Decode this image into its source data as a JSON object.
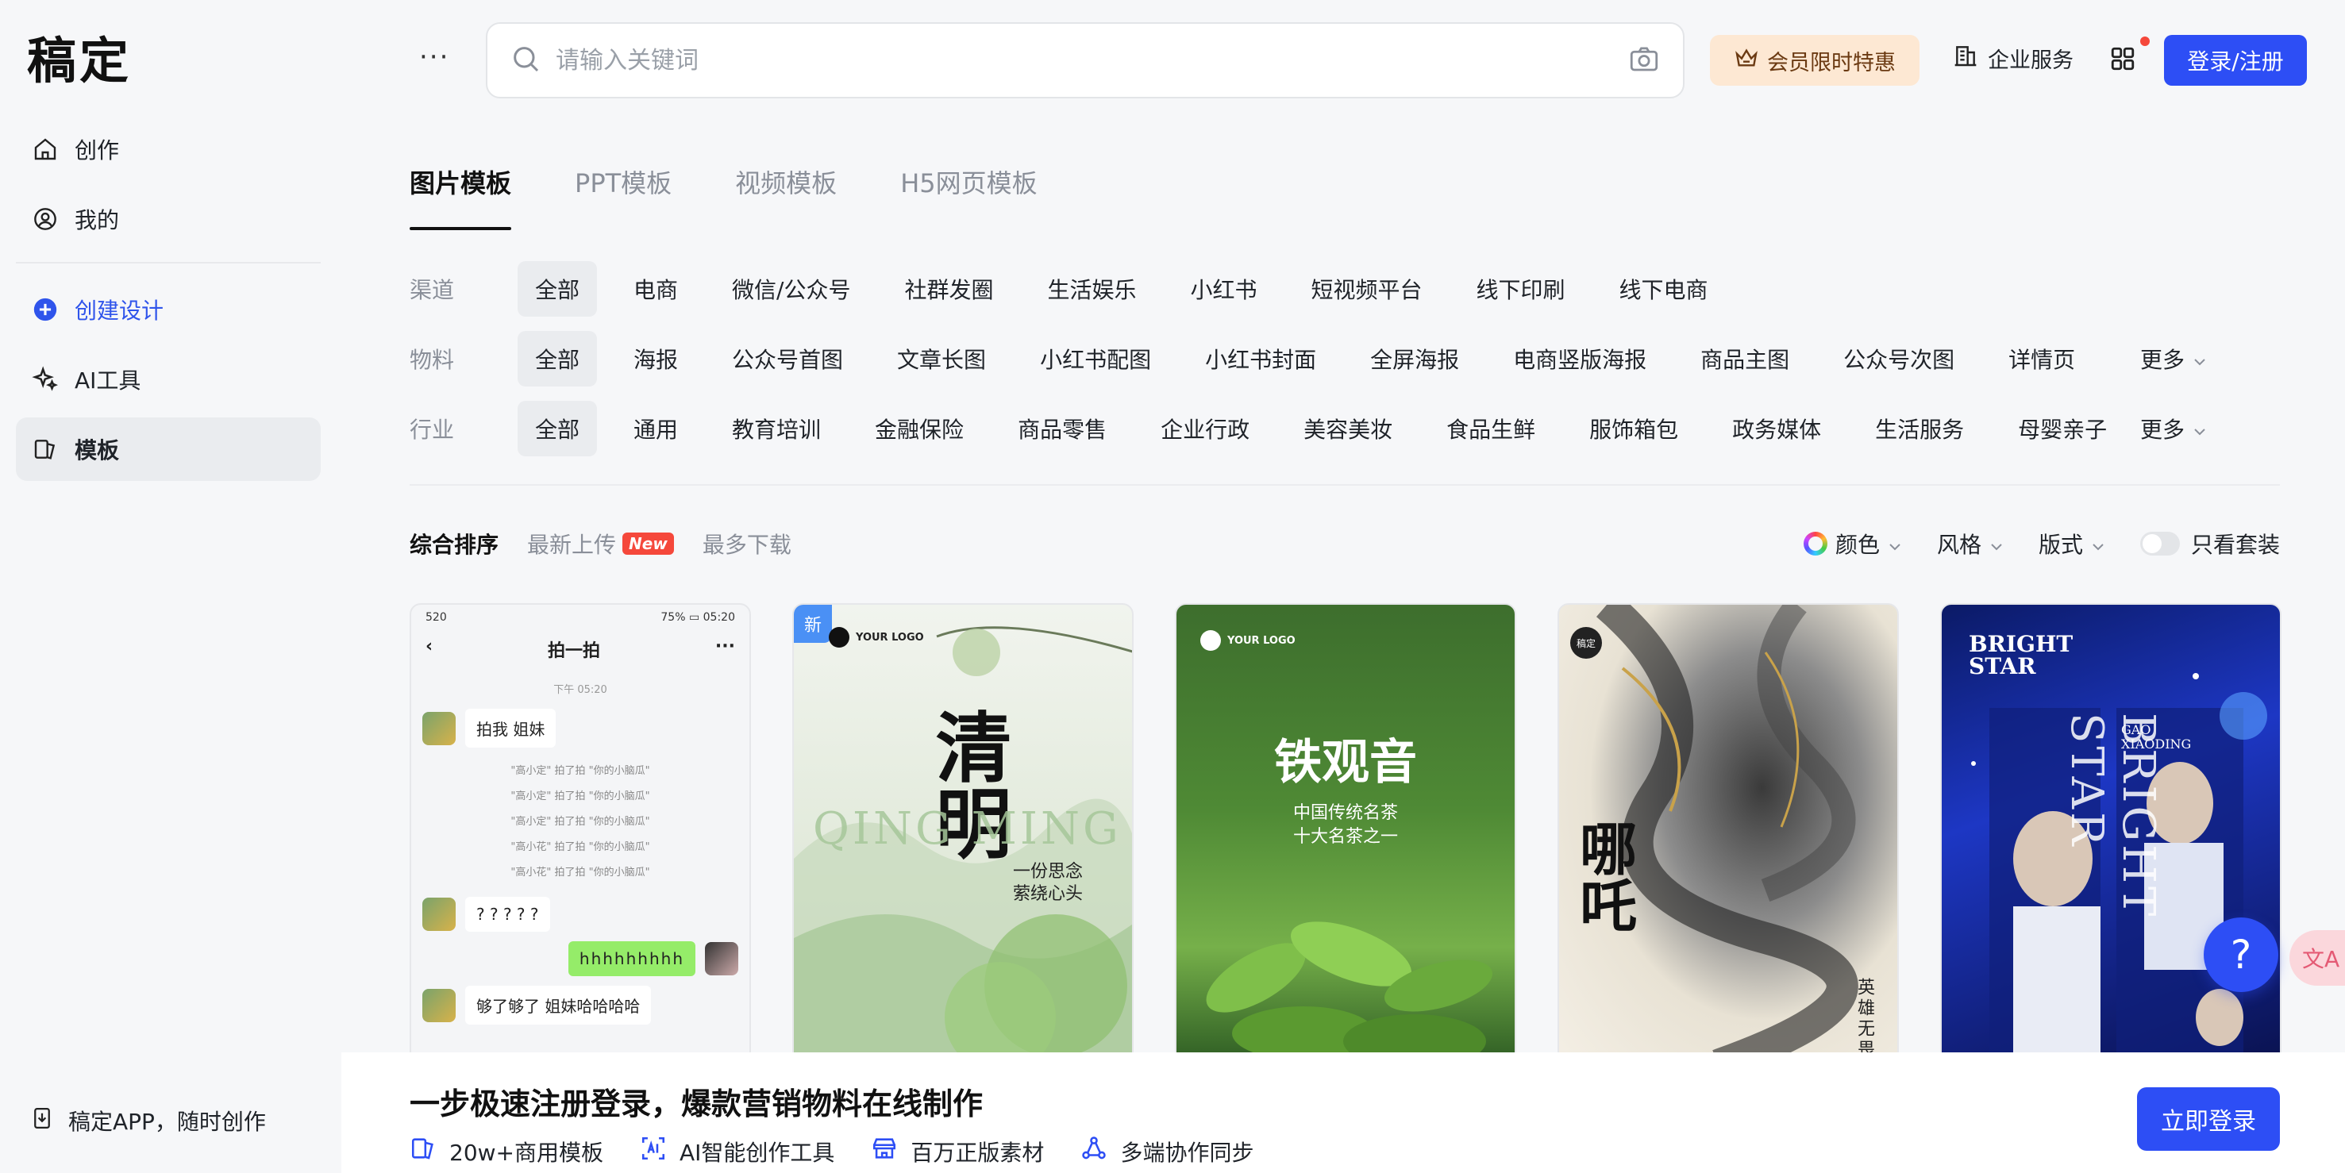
{
  "app": {
    "logo": "稿定"
  },
  "sidebar": {
    "items": [
      {
        "label": "创作",
        "icon": "home-icon"
      },
      {
        "label": "我的",
        "icon": "user-icon"
      },
      {
        "label": "创建设计",
        "icon": "plus-circle-icon"
      },
      {
        "label": "AI工具",
        "icon": "sparkle-icon"
      },
      {
        "label": "模板",
        "icon": "template-icon",
        "active": true
      }
    ],
    "app_link": "稿定APP，随时创作"
  },
  "header": {
    "search_placeholder": "请输入关键词",
    "vip_label": "会员限时特惠",
    "enterprise_label": "企业服务",
    "login_label": "登录/注册"
  },
  "tabs": [
    "图片模板",
    "PPT模板",
    "视频模板",
    "H5网页模板"
  ],
  "filters": {
    "channel": {
      "label": "渠道",
      "options": [
        "全部",
        "电商",
        "微信/公众号",
        "社群发圈",
        "生活娱乐",
        "小红书",
        "短视频平台",
        "线下印刷",
        "线下电商"
      ]
    },
    "material": {
      "label": "物料",
      "options": [
        "全部",
        "海报",
        "公众号首图",
        "文章长图",
        "小红书配图",
        "小红书封面",
        "全屏海报",
        "电商竖版海报",
        "商品主图",
        "公众号次图",
        "详情页"
      ],
      "more": "更多"
    },
    "industry": {
      "label": "行业",
      "options": [
        "全部",
        "通用",
        "教育培训",
        "金融保险",
        "商品零售",
        "企业行政",
        "美容美妆",
        "食品生鲜",
        "服饰箱包",
        "政务媒体",
        "生活服务",
        "母婴亲子"
      ],
      "more": "更多"
    }
  },
  "sort": {
    "comprehensive": "综合排序",
    "latest": "最新上传",
    "new_badge": "New",
    "most_downloads": "最多下载",
    "color": "颜色",
    "style": "风格",
    "layout": "版式",
    "only_sets": "只看套装"
  },
  "cards": {
    "c1": {
      "signal": "520",
      "battery": "75%",
      "clock": "05:20",
      "title": "拍一拍",
      "time": "下午 05:20",
      "msg1": "拍我 姐妹",
      "pats": [
        "\"高小定\" 拍了拍 \"你的小脑瓜\"",
        "\"高小定\" 拍了拍 \"你的小脑瓜\"",
        "\"高小定\" 拍了拍 \"你的小脑瓜\"",
        "\"高小花\" 拍了拍 \"你的小脑瓜\"",
        "\"高小花\" 拍了拍 \"你的小脑瓜\""
      ],
      "msg2": "? ? ? ? ?",
      "msg3": "hhhhhhhhh",
      "msg4": "够了够了 姐妹哈哈哈哈"
    },
    "c2": {
      "badge": "新",
      "logo": "YOUR LOGO",
      "title": "清明",
      "latin": "QING MING",
      "sub1": "一份思念",
      "sub2": "萦绕心头"
    },
    "c3": {
      "logo": "YOUR LOGO",
      "title": "铁观音",
      "sub1": "中国传统名茶",
      "sub2": "十大名茶之一"
    },
    "c4": {
      "badge": "稿定",
      "title": "哪吒",
      "side": "英雄无畏"
    },
    "c5": {
      "title1": "BRIGHT",
      "title2": "STAR",
      "name1": "GAO",
      "name2": "XIAODING",
      "vertical": "BRIGHT STAR"
    }
  },
  "banner": {
    "title": "一步极速注册登录，爆款营销物料在线制作",
    "features": [
      "20w+商用模板",
      "AI智能创作工具",
      "百万正版素材",
      "多端协作同步"
    ],
    "login": "立即登录"
  },
  "help": "?",
  "translate": "文A"
}
